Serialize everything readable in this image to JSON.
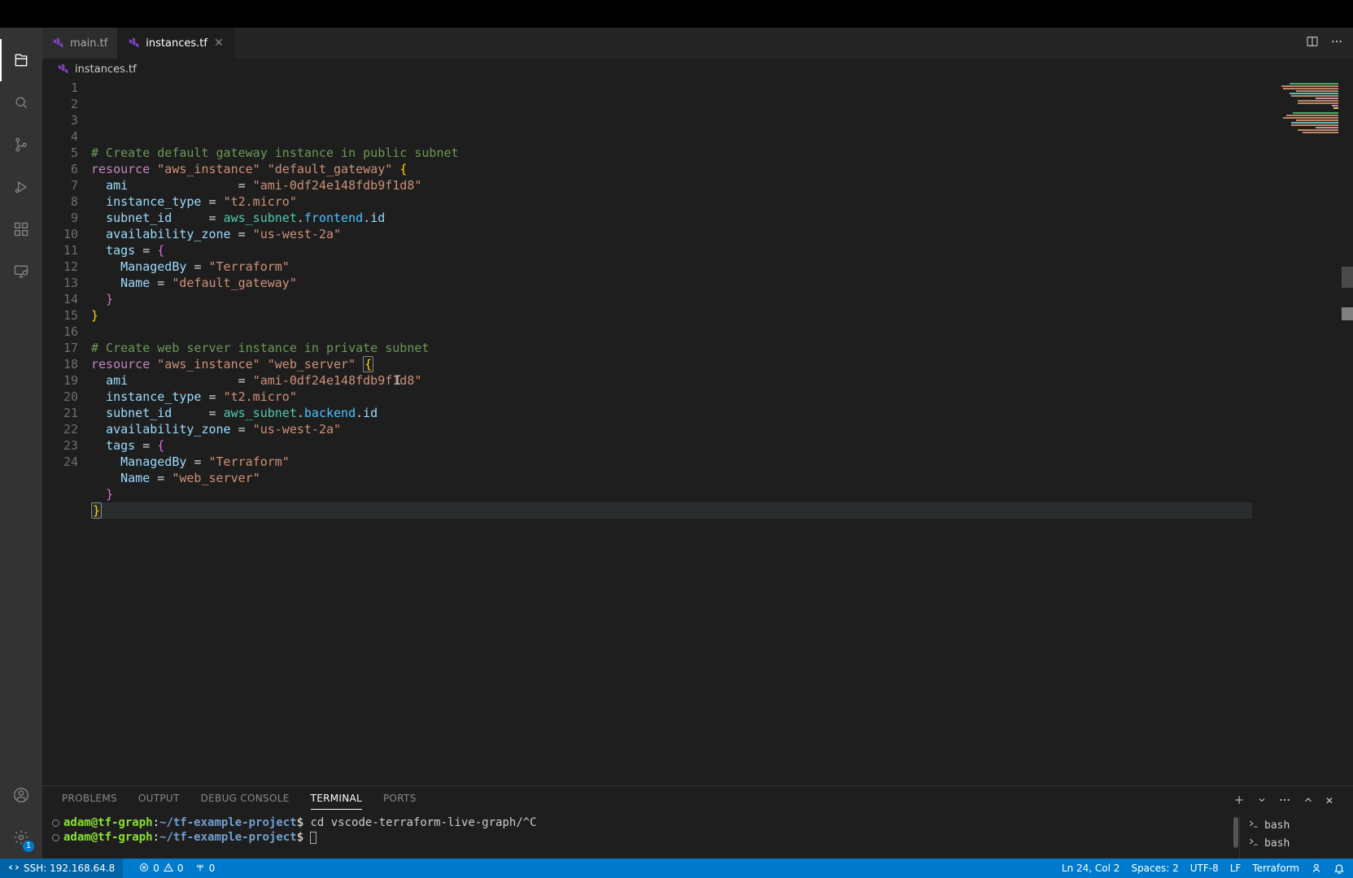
{
  "tabs": {
    "main": {
      "label": "main.tf"
    },
    "instances": {
      "label": "instances.tf"
    }
  },
  "breadcrumb": {
    "file": "instances.tf"
  },
  "code": {
    "lines": [
      {
        "n": 1,
        "segs": []
      },
      {
        "n": 2,
        "segs": [
          {
            "t": "# Create default gateway instance in public subnet",
            "c": "tok-comment"
          }
        ]
      },
      {
        "n": 3,
        "segs": [
          {
            "t": "resource ",
            "c": "tok-kw"
          },
          {
            "t": "\"aws_instance\" ",
            "c": "tok-str"
          },
          {
            "t": "\"default_gateway\" ",
            "c": "tok-str"
          },
          {
            "t": "{",
            "c": "tok-brace"
          }
        ]
      },
      {
        "n": 4,
        "segs": [
          {
            "t": "  "
          },
          {
            "t": "ami",
            "c": "tok-prop"
          },
          {
            "t": "               "
          },
          {
            "t": "=",
            "c": "tok-op"
          },
          {
            "t": " "
          },
          {
            "t": "\"ami-0df24e148fdb9f1d8\"",
            "c": "tok-str"
          }
        ]
      },
      {
        "n": 5,
        "segs": [
          {
            "t": "  "
          },
          {
            "t": "instance_type",
            "c": "tok-prop"
          },
          {
            "t": " "
          },
          {
            "t": "=",
            "c": "tok-op"
          },
          {
            "t": " "
          },
          {
            "t": "\"t2.micro\"",
            "c": "tok-str"
          }
        ]
      },
      {
        "n": 6,
        "segs": [
          {
            "t": "  "
          },
          {
            "t": "subnet_id",
            "c": "tok-prop"
          },
          {
            "t": "     "
          },
          {
            "t": "=",
            "c": "tok-op"
          },
          {
            "t": " "
          },
          {
            "t": "aws_subnet",
            "c": "tok-type"
          },
          {
            "t": ".",
            "c": "tok-punc"
          },
          {
            "t": "frontend",
            "c": "tok-obj"
          },
          {
            "t": ".",
            "c": "tok-punc"
          },
          {
            "t": "id",
            "c": "tok-prop"
          }
        ]
      },
      {
        "n": 7,
        "segs": [
          {
            "t": "  "
          },
          {
            "t": "availability_zone",
            "c": "tok-prop"
          },
          {
            "t": " "
          },
          {
            "t": "=",
            "c": "tok-op"
          },
          {
            "t": " "
          },
          {
            "t": "\"us-west-2a\"",
            "c": "tok-str"
          }
        ]
      },
      {
        "n": 8,
        "segs": [
          {
            "t": "  "
          },
          {
            "t": "tags",
            "c": "tok-prop"
          },
          {
            "t": " "
          },
          {
            "t": "=",
            "c": "tok-op"
          },
          {
            "t": " "
          },
          {
            "t": "{",
            "c": "tok-brace2"
          }
        ]
      },
      {
        "n": 9,
        "segs": [
          {
            "t": "    "
          },
          {
            "t": "ManagedBy",
            "c": "tok-prop"
          },
          {
            "t": " "
          },
          {
            "t": "=",
            "c": "tok-op"
          },
          {
            "t": " "
          },
          {
            "t": "\"Terraform\"",
            "c": "tok-str"
          }
        ]
      },
      {
        "n": 10,
        "segs": [
          {
            "t": "    "
          },
          {
            "t": "Name",
            "c": "tok-prop"
          },
          {
            "t": " "
          },
          {
            "t": "=",
            "c": "tok-op"
          },
          {
            "t": " "
          },
          {
            "t": "\"default_gateway\"",
            "c": "tok-str"
          }
        ]
      },
      {
        "n": 11,
        "segs": [
          {
            "t": "  "
          },
          {
            "t": "}",
            "c": "tok-brace2"
          }
        ]
      },
      {
        "n": 12,
        "segs": [
          {
            "t": "}",
            "c": "tok-brace"
          }
        ]
      },
      {
        "n": 13,
        "segs": []
      },
      {
        "n": 14,
        "segs": [
          {
            "t": "# Create web server instance in private subnet",
            "c": "tok-comment"
          }
        ]
      },
      {
        "n": 15,
        "segs": [
          {
            "t": "resource ",
            "c": "tok-kw"
          },
          {
            "t": "\"aws_instance\" ",
            "c": "tok-str"
          },
          {
            "t": "\"web_server\" ",
            "c": "tok-str"
          },
          {
            "t": "{",
            "c": "tok-brace sel-brace"
          }
        ]
      },
      {
        "n": 16,
        "segs": [
          {
            "t": "  "
          },
          {
            "t": "ami",
            "c": "tok-prop"
          },
          {
            "t": "               "
          },
          {
            "t": "=",
            "c": "tok-op"
          },
          {
            "t": " "
          },
          {
            "t": "\"ami-0df24e148fdb9f1d8\"",
            "c": "tok-str"
          }
        ]
      },
      {
        "n": 17,
        "segs": [
          {
            "t": "  "
          },
          {
            "t": "instance_type",
            "c": "tok-prop"
          },
          {
            "t": " "
          },
          {
            "t": "=",
            "c": "tok-op"
          },
          {
            "t": " "
          },
          {
            "t": "\"t2.micro\"",
            "c": "tok-str"
          }
        ]
      },
      {
        "n": 18,
        "segs": [
          {
            "t": "  "
          },
          {
            "t": "subnet_id",
            "c": "tok-prop"
          },
          {
            "t": "     "
          },
          {
            "t": "=",
            "c": "tok-op"
          },
          {
            "t": " "
          },
          {
            "t": "aws_subnet",
            "c": "tok-type"
          },
          {
            "t": ".",
            "c": "tok-punc"
          },
          {
            "t": "backend",
            "c": "tok-obj"
          },
          {
            "t": ".",
            "c": "tok-punc"
          },
          {
            "t": "id",
            "c": "tok-prop"
          }
        ]
      },
      {
        "n": 19,
        "segs": [
          {
            "t": "  "
          },
          {
            "t": "availability_zone",
            "c": "tok-prop"
          },
          {
            "t": " "
          },
          {
            "t": "=",
            "c": "tok-op"
          },
          {
            "t": " "
          },
          {
            "t": "\"us-west-2a\"",
            "c": "tok-str"
          }
        ]
      },
      {
        "n": 20,
        "segs": [
          {
            "t": "  "
          },
          {
            "t": "tags",
            "c": "tok-prop"
          },
          {
            "t": " "
          },
          {
            "t": "=",
            "c": "tok-op"
          },
          {
            "t": " "
          },
          {
            "t": "{",
            "c": "tok-brace2"
          }
        ]
      },
      {
        "n": 21,
        "segs": [
          {
            "t": "    "
          },
          {
            "t": "ManagedBy",
            "c": "tok-prop"
          },
          {
            "t": " "
          },
          {
            "t": "=",
            "c": "tok-op"
          },
          {
            "t": " "
          },
          {
            "t": "\"Terraform\"",
            "c": "tok-str"
          }
        ]
      },
      {
        "n": 22,
        "segs": [
          {
            "t": "    "
          },
          {
            "t": "Name",
            "c": "tok-prop"
          },
          {
            "t": " "
          },
          {
            "t": "=",
            "c": "tok-op"
          },
          {
            "t": " "
          },
          {
            "t": "\"web_server\"",
            "c": "tok-str"
          }
        ]
      },
      {
        "n": 23,
        "segs": [
          {
            "t": "  "
          },
          {
            "t": "}",
            "c": "tok-brace2"
          }
        ]
      },
      {
        "n": 24,
        "hl": true,
        "segs": [
          {
            "t": "}",
            "c": "tok-brace sel-brace"
          }
        ]
      }
    ]
  },
  "panel": {
    "tabs": {
      "problems": "PROBLEMS",
      "output": "OUTPUT",
      "debug": "DEBUG CONSOLE",
      "terminal": "TERMINAL",
      "ports": "PORTS"
    },
    "terminal": {
      "user": "adam@tf-graph",
      "path": "~/tf-example-project",
      "prompt": "$",
      "line1_cmd": " cd vscode-terraform-live-graph/^C",
      "line2_cmd": " ",
      "sidebar": {
        "item1": "bash",
        "item2": "bash"
      }
    }
  },
  "status": {
    "remote": "SSH: 192.168.64.8",
    "errors": "0",
    "warnings": "0",
    "ports": "0",
    "cursor": "Ln 24, Col 2",
    "spaces": "Spaces: 2",
    "encoding": "UTF-8",
    "eol": "LF",
    "lang": "Terraform"
  },
  "activity": {
    "badge": "1"
  }
}
